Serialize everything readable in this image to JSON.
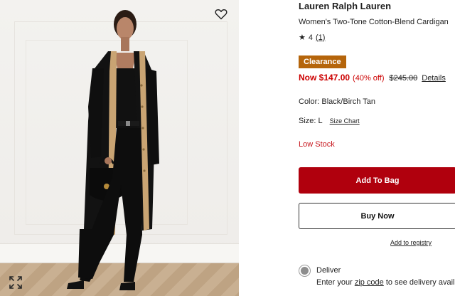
{
  "product": {
    "brand": "Lauren Ralph Lauren",
    "title": "Women's Two-Tone Cotton-Blend Cardigan",
    "rating_value": "4",
    "rating_count": "(1)",
    "badge": "Clearance",
    "price_now": "Now $147.00",
    "price_pct": "(40% off)",
    "price_original": "$245.00",
    "price_details": "Details",
    "color": "Color: Black/Birch Tan",
    "size_label": "Size: L",
    "size_chart": "Size Chart",
    "stock_status": "Low Stock"
  },
  "actions": {
    "add_to_bag": "Add To Bag",
    "buy_now": "Buy Now",
    "registry": "Add to registry"
  },
  "delivery": {
    "label": "Deliver",
    "note_prefix": "Enter your",
    "zip_link": "zip code",
    "note_suffix": "to see delivery availab"
  },
  "icons": {
    "favorite": "heart-icon",
    "expand": "expand-icon",
    "rating": "star-icon"
  },
  "colors": {
    "accent_red": "#b0000d",
    "sale_red": "#cc0000",
    "badge_orange": "#b5650b",
    "low_stock": "#c7161d"
  }
}
